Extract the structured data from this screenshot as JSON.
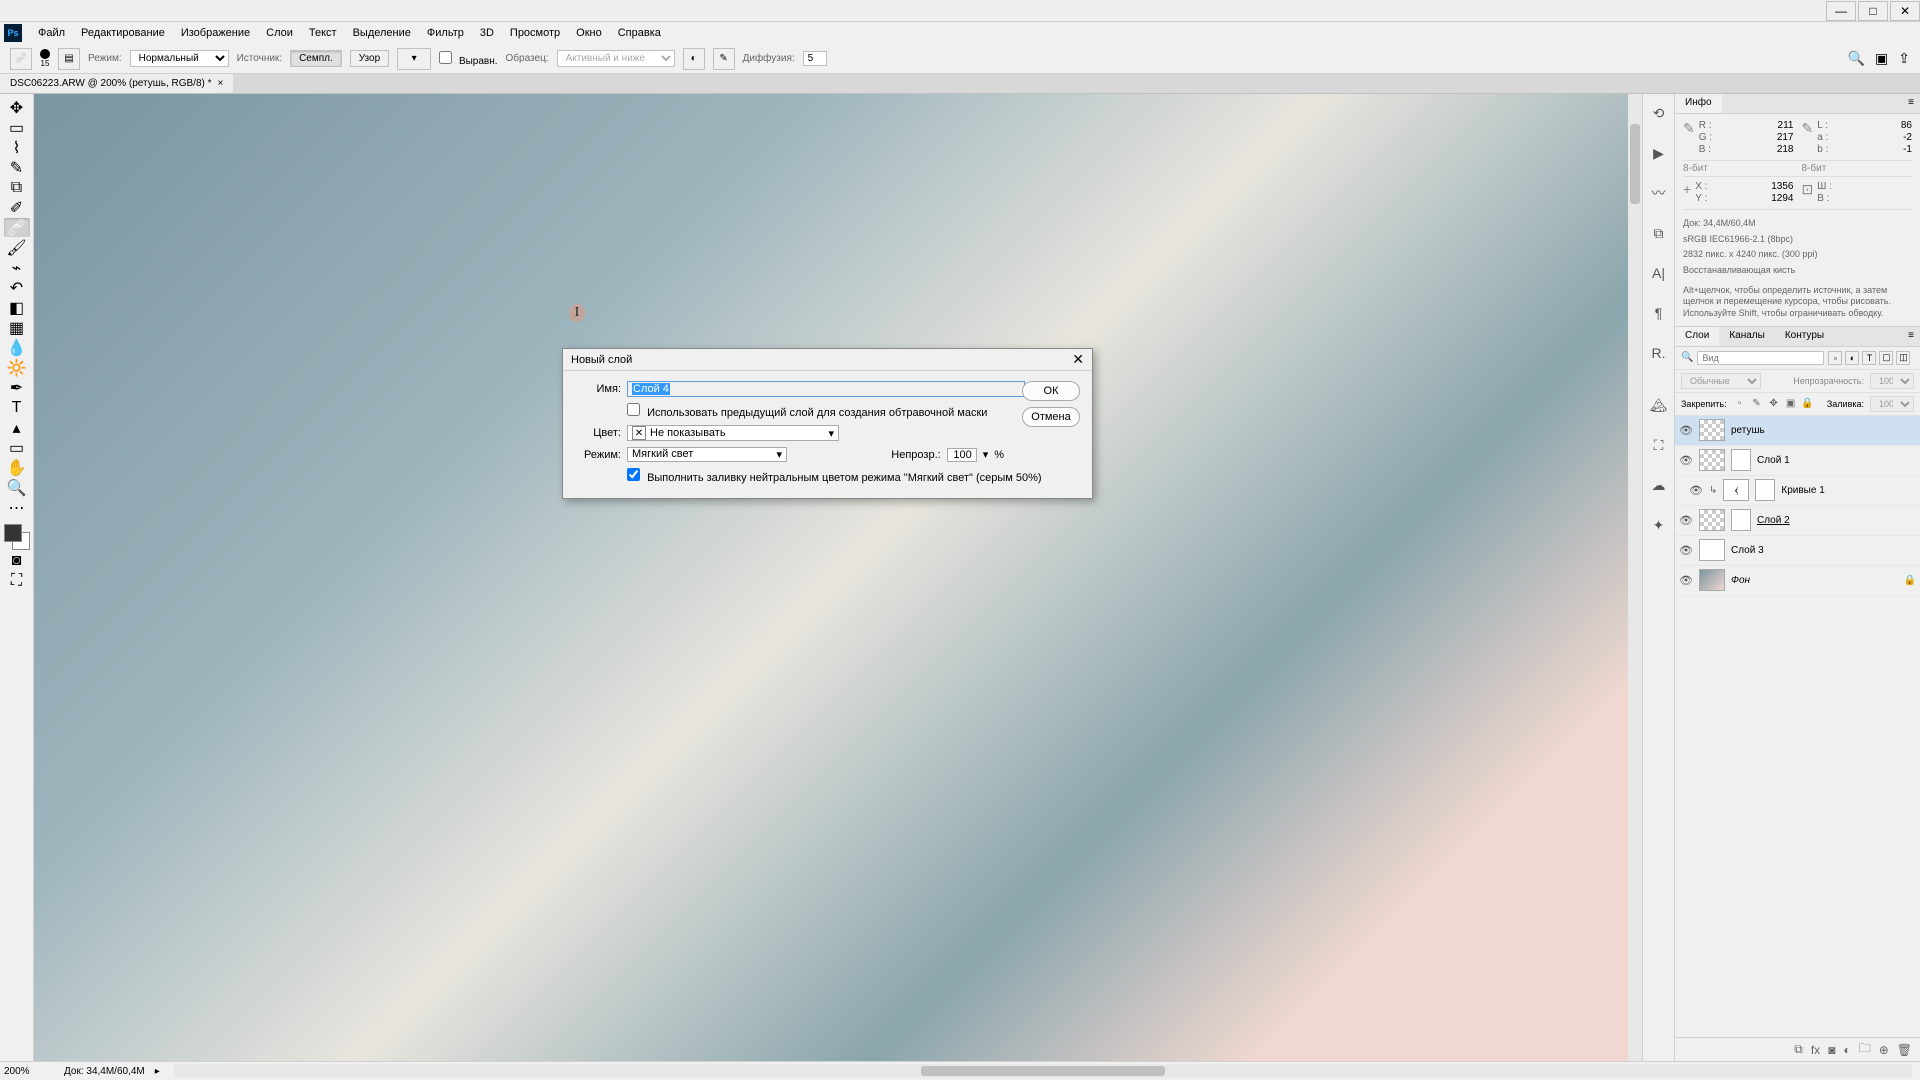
{
  "window": {
    "min": "—",
    "max": "□",
    "close": "✕"
  },
  "menu": [
    "Файл",
    "Редактирование",
    "Изображение",
    "Слои",
    "Текст",
    "Выделение",
    "Фильтр",
    "3D",
    "Просмотр",
    "Окно",
    "Справка"
  ],
  "options": {
    "brush_size": "15",
    "mode_label": "Режим:",
    "mode_value": "Нормальный",
    "source_label": "Источник:",
    "sample": "Семпл.",
    "pattern": "Узор",
    "aligned": "Выравн.",
    "sample_from": "Образец:",
    "sample_from_value": "Активный и ниже",
    "diffusion_label": "Диффузия:",
    "diffusion_value": "5"
  },
  "doc_tab": {
    "title": "DSC06223.ARW @ 200% (ретушь, RGB/8) *"
  },
  "info": {
    "tab": "Инфо",
    "rgb": {
      "labels": [
        "R :",
        "G :",
        "B :"
      ],
      "values": [
        "211",
        "217",
        "218"
      ]
    },
    "lab": {
      "labels": [
        "L :",
        "a :",
        "b :"
      ],
      "values": [
        "86",
        "-2",
        "-1"
      ]
    },
    "bits": "8-бит",
    "xy": {
      "labels": [
        "X :",
        "Y :"
      ],
      "values": [
        "1356",
        "1294"
      ]
    },
    "wh": {
      "labels": [
        "Ш :",
        "В :"
      ],
      "values": [
        "",
        ""
      ]
    },
    "doc_line1": "Док: 34,4M/60,4M",
    "doc_line2": "sRGB IEC61966-2.1 (8bpc)",
    "doc_line3": "2832 пикс. x 4240 пикс. (300 ppi)",
    "doc_line4": "Восстанавливающая кисть",
    "hint": "Alt+щелчок, чтобы определить источник, а затем щелчок и перемещение курсора, чтобы рисовать. Используйте Shift, чтобы ограничивать обводку."
  },
  "layers": {
    "tabs": [
      "Слои",
      "Каналы",
      "Контуры"
    ],
    "kind": "Вид",
    "blend": "Обычные",
    "opacity_label": "Непрозрачность:",
    "opacity_value": "100%",
    "lock_label": "Закрепить:",
    "fill_label": "Заливка:",
    "fill_value": "100%",
    "items": [
      {
        "name": "ретушь"
      },
      {
        "name": "Слой 1"
      },
      {
        "name": "Кривые 1"
      },
      {
        "name": "Слой 2"
      },
      {
        "name": "Слой 3"
      },
      {
        "name": "Фон"
      }
    ]
  },
  "status": {
    "zoom": "200%",
    "doc": "Док: 34,4M/60,4M"
  },
  "dialog": {
    "title": "Новый слой",
    "name_label": "Имя:",
    "name_value": "Слой 4",
    "use_prev": "Использовать предыдущий слой для создания обтравочной маски",
    "color_label": "Цвет:",
    "color_value": "Не показывать",
    "mode_label": "Режим:",
    "mode_value": "Мягкий свет",
    "opacity_label": "Непрозр.:",
    "opacity_value": "100",
    "opacity_suffix": "%",
    "fill_neutral": "Выполнить заливку нейтральным цветом режима \"Мягкий свет\"  (серым 50%)",
    "ok": "ОК",
    "cancel": "Отмена"
  }
}
